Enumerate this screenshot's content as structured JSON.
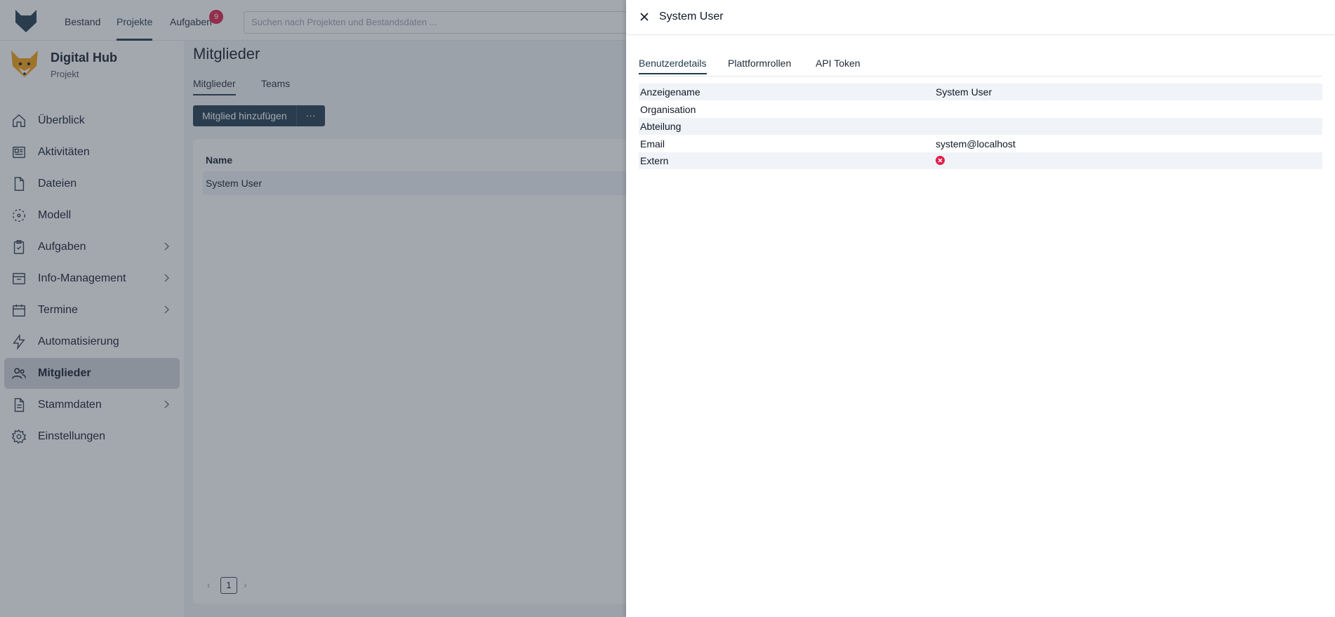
{
  "topnav": {
    "items": [
      {
        "label": "Bestand"
      },
      {
        "label": "Projekte"
      },
      {
        "label": "Aufgaben"
      }
    ],
    "tasks_badge": "9",
    "search_placeholder": "Suchen nach Projekten und Bestandsdaten ..."
  },
  "project": {
    "name": "Digital Hub",
    "subtitle": "Projekt"
  },
  "sidebar": {
    "items": [
      {
        "label": "Überblick",
        "icon": "home-icon"
      },
      {
        "label": "Aktivitäten",
        "icon": "newspaper-icon"
      },
      {
        "label": "Dateien",
        "icon": "file-icon"
      },
      {
        "label": "Modell",
        "icon": "model-icon"
      },
      {
        "label": "Aufgaben",
        "icon": "clipboard-check-icon"
      },
      {
        "label": "Info-Management",
        "icon": "inbox-icon"
      },
      {
        "label": "Termine",
        "icon": "calendar-icon"
      },
      {
        "label": "Automatisierung",
        "icon": "lightning-icon"
      },
      {
        "label": "Mitglieder",
        "icon": "users-icon"
      },
      {
        "label": "Stammdaten",
        "icon": "document-icon"
      },
      {
        "label": "Einstellungen",
        "icon": "gear-icon"
      }
    ]
  },
  "main": {
    "title": "Mitglieder",
    "tabs": [
      {
        "label": "Mitglieder"
      },
      {
        "label": "Teams"
      }
    ],
    "add_button": "Mitglied hinzufügen",
    "more_button": "···",
    "table": {
      "header_name": "Name",
      "rows": [
        {
          "name": "System User"
        }
      ]
    },
    "pagination": {
      "current_page": "1"
    }
  },
  "drawer": {
    "title": "System User",
    "tabs": [
      {
        "label": "Benutzerdetails"
      },
      {
        "label": "Plattformrollen"
      },
      {
        "label": "API Token"
      }
    ],
    "details": [
      {
        "key": "Anzeigename",
        "value": "System User"
      },
      {
        "key": "Organisation",
        "value": ""
      },
      {
        "key": "Abteilung",
        "value": ""
      },
      {
        "key": "Email",
        "value": "system@localhost"
      },
      {
        "key": "Extern",
        "value": ""
      }
    ]
  },
  "colors": {
    "primary": "#1e3a4c",
    "badge": "#e11d48",
    "active_sidebar": "#d1d5db",
    "stripe": "#f0f3f7"
  }
}
